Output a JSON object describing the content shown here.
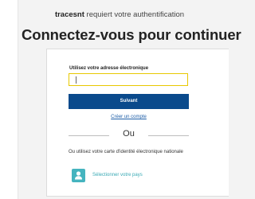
{
  "header": {
    "app_name": "tracesnt",
    "subtitle_rest": " requiert votre authentification",
    "title": "Connectez-vous pour continuer"
  },
  "login_form": {
    "email_label": "Utilisez votre adresse électronique",
    "email_value": "",
    "submit_label": "Suivant",
    "create_account_label": "Créer un compte"
  },
  "separator": {
    "or_label": "Ou"
  },
  "eid": {
    "description": "Ou utilisez votre carte d'identité électronique nationale",
    "select_country_label": "Sélectionner votre pays"
  },
  "colors": {
    "primary": "#0a4a8c",
    "input_focus_border": "#e8c800",
    "link": "#1f5fa8",
    "accent_teal": "#45b4bf"
  },
  "icons": {
    "country": "person-icon"
  }
}
